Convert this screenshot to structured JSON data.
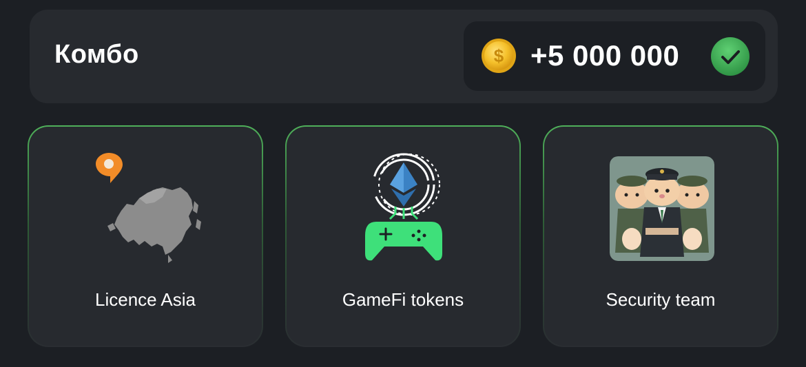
{
  "combo": {
    "title": "Комбо",
    "reward": "+5 000 000",
    "completed": true
  },
  "colors": {
    "background": "#1c1f24",
    "panel": "#272a2f",
    "accent_green": "#4fb05a",
    "coin_gold": "#f5c12b",
    "check_green": "#3aa651"
  },
  "icons": {
    "coin": "coin-icon",
    "check": "check-icon"
  },
  "cards": [
    {
      "label": "Licence Asia",
      "image": "asia-map-with-pin-image"
    },
    {
      "label": "GameFi tokens",
      "image": "ethereum-coin-gamepad-image"
    },
    {
      "label": "Security team",
      "image": "hamster-security-guards-image"
    }
  ]
}
